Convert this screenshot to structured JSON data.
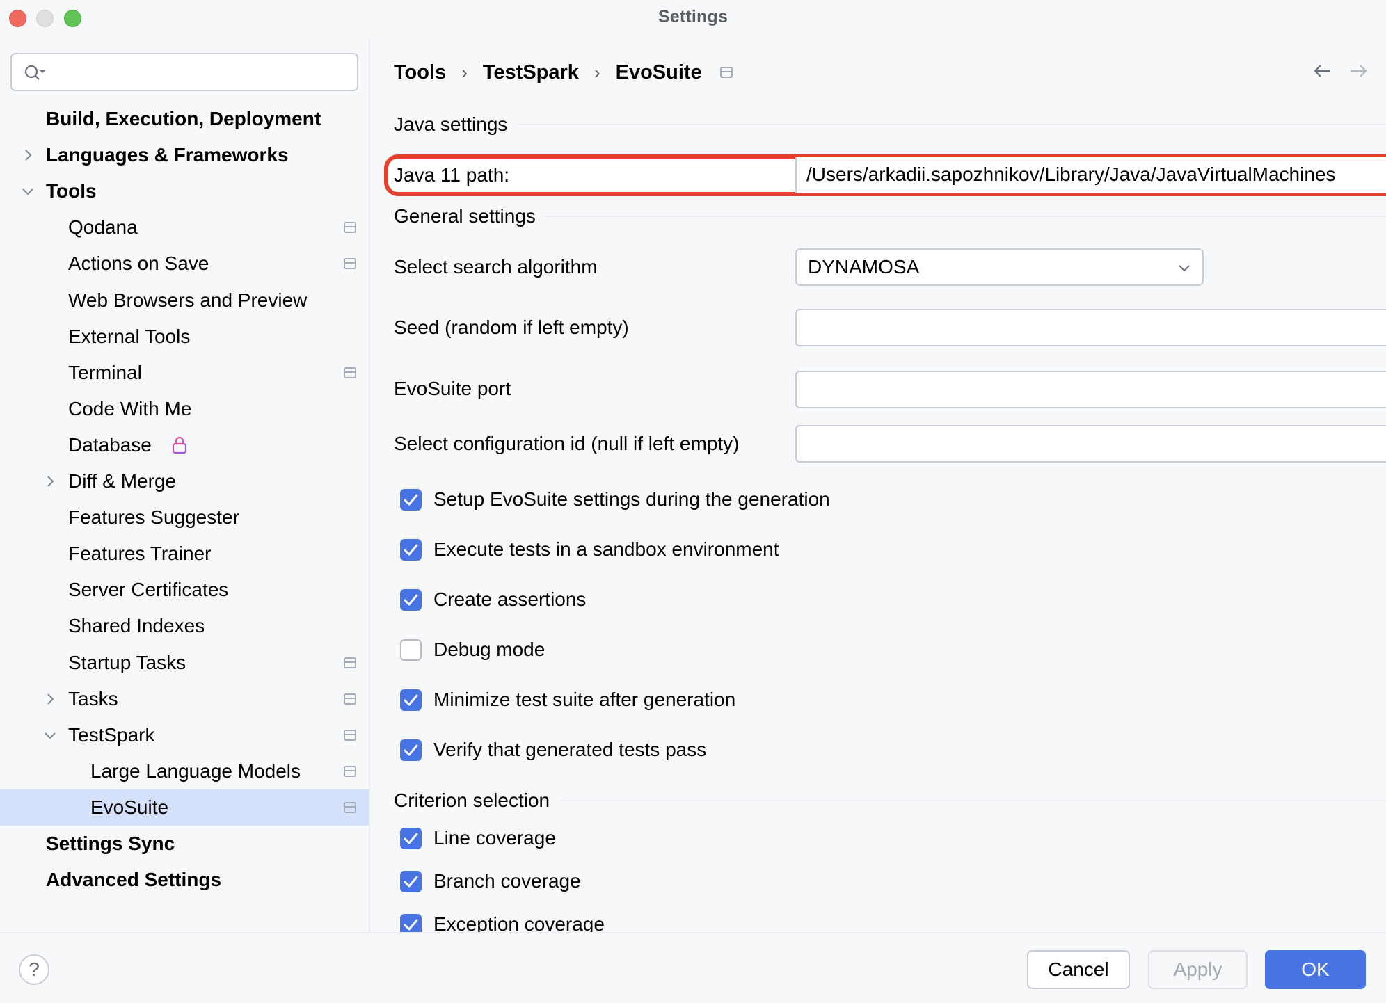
{
  "window": {
    "title": "Settings"
  },
  "sidebar": {
    "search": {
      "value": "",
      "placeholder": ""
    },
    "items": [
      {
        "label": "Build, Execution, Deployment",
        "bold": true,
        "level": 0,
        "expander": "none",
        "page_icon": false
      },
      {
        "label": "Languages & Frameworks",
        "bold": true,
        "level": 0,
        "expander": "collapsed",
        "page_icon": false
      },
      {
        "label": "Tools",
        "bold": true,
        "level": 0,
        "expander": "expanded",
        "page_icon": false
      },
      {
        "label": "Qodana",
        "bold": false,
        "level": 1,
        "expander": "none",
        "page_icon": true
      },
      {
        "label": "Actions on Save",
        "bold": false,
        "level": 1,
        "expander": "none",
        "page_icon": true
      },
      {
        "label": "Web Browsers and Preview",
        "bold": false,
        "level": 1,
        "expander": "none",
        "page_icon": false
      },
      {
        "label": "External Tools",
        "bold": false,
        "level": 1,
        "expander": "none",
        "page_icon": false
      },
      {
        "label": "Terminal",
        "bold": false,
        "level": 1,
        "expander": "none",
        "page_icon": true
      },
      {
        "label": "Code With Me",
        "bold": false,
        "level": 1,
        "expander": "none",
        "page_icon": false
      },
      {
        "label": "Database",
        "bold": false,
        "level": 1,
        "expander": "none",
        "page_icon": false,
        "lock": true
      },
      {
        "label": "Diff & Merge",
        "bold": false,
        "level": 1,
        "expander": "collapsed",
        "page_icon": false
      },
      {
        "label": "Features Suggester",
        "bold": false,
        "level": 1,
        "expander": "none",
        "page_icon": false
      },
      {
        "label": "Features Trainer",
        "bold": false,
        "level": 1,
        "expander": "none",
        "page_icon": false
      },
      {
        "label": "Server Certificates",
        "bold": false,
        "level": 1,
        "expander": "none",
        "page_icon": false
      },
      {
        "label": "Shared Indexes",
        "bold": false,
        "level": 1,
        "expander": "none",
        "page_icon": false
      },
      {
        "label": "Startup Tasks",
        "bold": false,
        "level": 1,
        "expander": "none",
        "page_icon": true
      },
      {
        "label": "Tasks",
        "bold": false,
        "level": 1,
        "expander": "collapsed",
        "page_icon": true
      },
      {
        "label": "TestSpark",
        "bold": false,
        "level": 1,
        "expander": "expanded",
        "page_icon": true
      },
      {
        "label": "Large Language Models",
        "bold": false,
        "level": 2,
        "expander": "none",
        "page_icon": true
      },
      {
        "label": "EvoSuite",
        "bold": false,
        "level": 2,
        "expander": "none",
        "page_icon": true,
        "selected": true
      },
      {
        "label": "Settings Sync",
        "bold": true,
        "level": 0,
        "expander": "none",
        "page_icon": false
      },
      {
        "label": "Advanced Settings",
        "bold": true,
        "level": 0,
        "expander": "none",
        "page_icon": false
      }
    ]
  },
  "breadcrumb": {
    "items": [
      "Tools",
      "TestSpark",
      "EvoSuite"
    ],
    "separator": "›"
  },
  "sections": {
    "java": "Java settings",
    "general": "General settings",
    "criterion": "Criterion selection"
  },
  "java": {
    "path_label": "Java 11 path:",
    "path_value": "/Users/arkadii.sapozhnikov/Library/Java/JavaVirtualMachines",
    "highlight_color": "#e5412c"
  },
  "general": {
    "algorithm_label": "Select search algorithm",
    "algorithm_value": "DYNAMOSA",
    "seed_label": "Seed (random if left empty)",
    "seed_value": "",
    "port_label": "EvoSuite port",
    "port_value": "",
    "config_label": "Select configuration id (null if left empty)",
    "config_value": "",
    "checkboxes": [
      {
        "label": "Setup EvoSuite settings during the generation",
        "checked": true
      },
      {
        "label": "Execute tests in a sandbox environment",
        "checked": true
      },
      {
        "label": "Create assertions",
        "checked": true
      },
      {
        "label": "Debug mode",
        "checked": false
      },
      {
        "label": "Minimize test suite after generation",
        "checked": true
      },
      {
        "label": "Verify that generated tests pass",
        "checked": true
      }
    ]
  },
  "criterion": {
    "checkboxes": [
      {
        "label": "Line coverage",
        "checked": true
      },
      {
        "label": "Branch coverage",
        "checked": true
      },
      {
        "label": "Exception coverage",
        "checked": true
      }
    ]
  },
  "footer": {
    "help_label": "?",
    "cancel_label": "Cancel",
    "apply_label": "Apply",
    "ok_label": "OK"
  },
  "colors": {
    "accent": "#4874e3",
    "selection": "#d5e1fb",
    "highlight": "#e5412c"
  }
}
